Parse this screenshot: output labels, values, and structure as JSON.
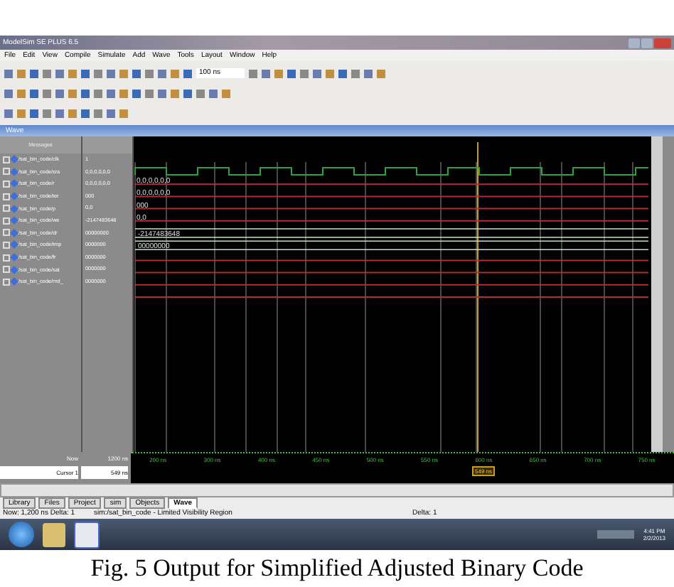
{
  "window": {
    "title": "ModelSim SE PLUS 6.5"
  },
  "menu": [
    "File",
    "Edit",
    "View",
    "Compile",
    "Simulate",
    "Add",
    "Wave",
    "Tools",
    "Layout",
    "Window",
    "Help"
  ],
  "toolbar": {
    "run_length": "100 ns"
  },
  "wave_window": {
    "title": "Wave",
    "header": "Messages",
    "signals": [
      {
        "name": "/sat_bin_code/clk",
        "value": "1",
        "kind": "clock"
      },
      {
        "name": "/sat_bin_code/sra",
        "value": "0,0,0,0,0,0",
        "kind": "bus",
        "wave_label": "0,0,0,0,0,0"
      },
      {
        "name": "/sat_bin_code/r",
        "value": "0,0,0,0,0,0",
        "kind": "bus",
        "wave_label": "0,0,0,0,0,0"
      },
      {
        "name": "/sat_bin_code/ter",
        "value": "000",
        "kind": "bus",
        "wave_label": "000"
      },
      {
        "name": "/sat_bin_code/p",
        "value": "0,0",
        "kind": "bus",
        "wave_label": "0,0"
      },
      {
        "name": "/sat_bin_code/we",
        "value": "-2147483648",
        "kind": "word",
        "wave_label": "-2147483648"
      },
      {
        "name": "/sat_bin_code/dr",
        "value": "00000000",
        "kind": "word",
        "wave_label": "00000000"
      },
      {
        "name": "/sat_bin_code/tmp",
        "value": "0000000",
        "kind": "bit"
      },
      {
        "name": "/sat_bin_code/fr",
        "value": "0000000",
        "kind": "bit"
      },
      {
        "name": "/sat_bin_code/sat",
        "value": "0000000",
        "kind": "bit"
      },
      {
        "name": "/sat_bin_code/rnd_",
        "value": "0000000",
        "kind": "bit"
      }
    ],
    "now_label": "Now",
    "now_value": "1200 ns",
    "cursor": {
      "name": "Cursor 1",
      "value": "549 ns",
      "label": "549 ns"
    },
    "ruler": [
      "200 ns",
      "300 ns",
      "400 ns",
      "450 ns",
      "500 ns",
      "550 ns",
      "600 ns",
      "650 ns",
      "700 ns",
      "750 ns"
    ]
  },
  "tabs": [
    {
      "label": "Library",
      "selected": false
    },
    {
      "label": "Files",
      "selected": false
    },
    {
      "label": "Project",
      "selected": false
    },
    {
      "label": "sim",
      "selected": false
    },
    {
      "label": "Objects",
      "selected": false
    },
    {
      "label": "Wave",
      "selected": true
    }
  ],
  "status_bar": [
    "Now: 1,200 ns Delta: 1",
    "sim:/sat_bin_code - Limited Visibility Region",
    "Delta: 1"
  ],
  "taskbar": {
    "clock_time": "4:41 PM",
    "clock_date": "2/2/2013"
  },
  "caption": "Fig. 5 Output for Simplified Adjusted Binary Code"
}
